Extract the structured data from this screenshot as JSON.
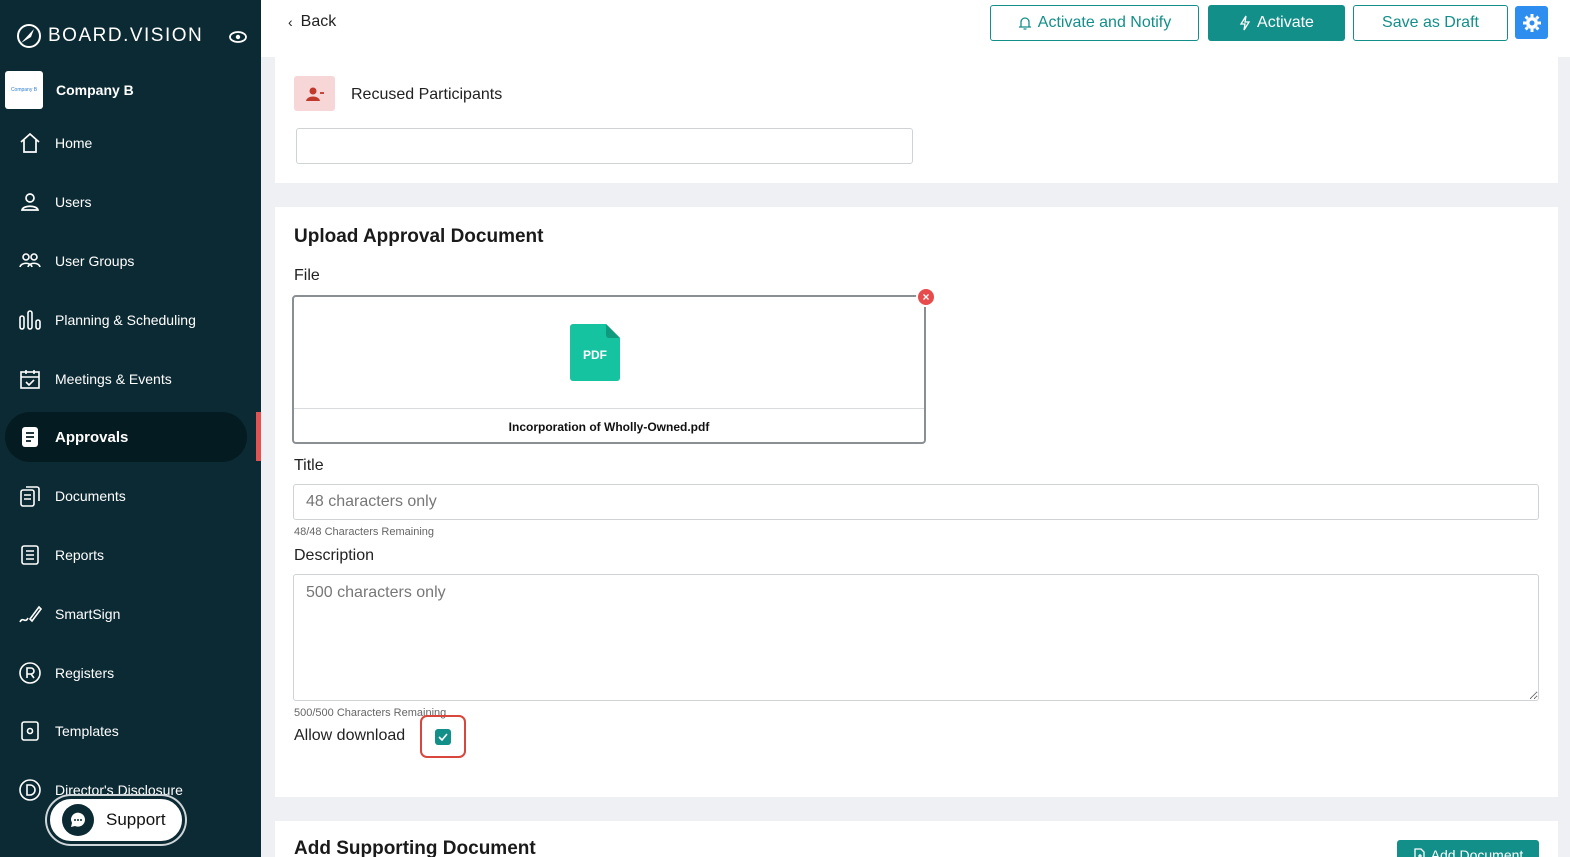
{
  "sidebar": {
    "brand": "BOARD.VISION",
    "company": {
      "logo_text": "Company B",
      "name": "Company B"
    },
    "items": [
      {
        "label": "Home",
        "icon": "home-icon"
      },
      {
        "label": "Users",
        "icon": "user-icon"
      },
      {
        "label": "User Groups",
        "icon": "user-group-icon"
      },
      {
        "label": "Planning & Scheduling",
        "icon": "bar-chart-icon"
      },
      {
        "label": "Meetings & Events",
        "icon": "calendar-icon"
      },
      {
        "label": "Approvals",
        "icon": "approval-doc-icon",
        "active": true
      },
      {
        "label": "Documents",
        "icon": "documents-icon"
      },
      {
        "label": "Reports",
        "icon": "report-icon"
      },
      {
        "label": "SmartSign",
        "icon": "signature-pen-icon"
      },
      {
        "label": "Registers",
        "icon": "registered-icon"
      },
      {
        "label": "Templates",
        "icon": "template-icon"
      },
      {
        "label": "Director's Disclosure",
        "icon": "disclosure-icon"
      }
    ],
    "support_label": "Support"
  },
  "topbar": {
    "back_label": "Back",
    "activate_notify_label": "Activate and Notify",
    "activate_label": "Activate",
    "save_draft_label": "Save as Draft"
  },
  "recused": {
    "label": "Recused Participants",
    "value": ""
  },
  "upload": {
    "section_title": "Upload Approval Document",
    "file_label": "File",
    "file_type": "PDF",
    "file_name": "Incorporation of Wholly-Owned.pdf",
    "title_label": "Title",
    "title_placeholder": "48 characters only",
    "title_hint": "48/48 Characters Remaining",
    "description_label": "Description",
    "description_placeholder": "500 characters only",
    "description_hint": "500/500 Characters Remaining",
    "allow_download_label": "Allow download",
    "allow_download": true
  },
  "supporting": {
    "section_title": "Add Supporting Document",
    "add_button_label": "Add Document"
  },
  "colors": {
    "sidebar_bg": "#0c2a33",
    "accent": "#138f8a",
    "highlight": "#d9473c",
    "gear_button": "#2e8ef0"
  }
}
